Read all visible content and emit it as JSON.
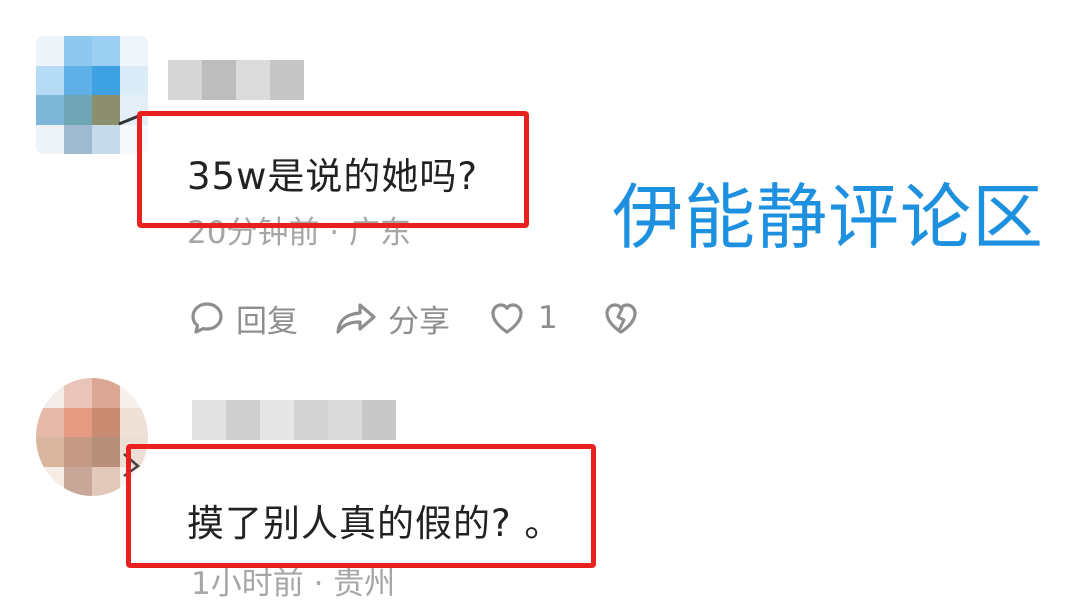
{
  "overlay": {
    "caption": "伊能静评论区",
    "caption_color": "#1d90e0"
  },
  "comments": [
    {
      "text": "35w是说的她吗?",
      "time": "20分钟前",
      "location": "广东",
      "meta": "20分钟前 · 广东",
      "actions": {
        "reply_label": "回复",
        "share_label": "分享",
        "like_count": "1"
      },
      "avatar_pixels": [
        "#eef4fa",
        "#8fc8ee",
        "#9cd0f2",
        "#eef5fb",
        "#b6dcf5",
        "#5fb0e6",
        "#3ea1e2",
        "#d9ecf8",
        "#7eb6d8",
        "#6fa4b4",
        "#8b8f6e",
        "#e3eef6",
        "#eef3f8",
        "#9fbad0",
        "#c8dbea",
        "#f6f8fb"
      ],
      "name_pixels": [
        "#d6d6d6",
        "#bdbdbd",
        "#dcdcdc",
        "#c6c6c6"
      ]
    },
    {
      "text": "摸了别人真的假的? 。",
      "time": "1小时前",
      "location": "贵州",
      "meta": "1小时前 · 贵州",
      "avatar_pixels": [
        "#f3ede9",
        "#e9c5b9",
        "#dca694",
        "#f6f0ec",
        "#e7b9a9",
        "#e49b82",
        "#c98c72",
        "#efe0d8",
        "#d8b59c",
        "#c49a84",
        "#b88f7b",
        "#eedfd6",
        "#f5ece6",
        "#c7a898",
        "#e2c9bc",
        "#f8f3f0"
      ],
      "name_pixels": [
        "#e2e2e2",
        "#cfcfcf",
        "#e6e6e6",
        "#d2d2d2",
        "#dadada",
        "#c8c8c8"
      ]
    }
  ],
  "colors": {
    "highlight": "#e8211f",
    "icon": "#8e8e8e",
    "meta_text": "#a6a6a6"
  },
  "icons": {
    "reply": "speech-bubble-icon",
    "share": "share-arrow-icon",
    "like": "heart-icon",
    "dislike": "broken-heart-icon"
  }
}
